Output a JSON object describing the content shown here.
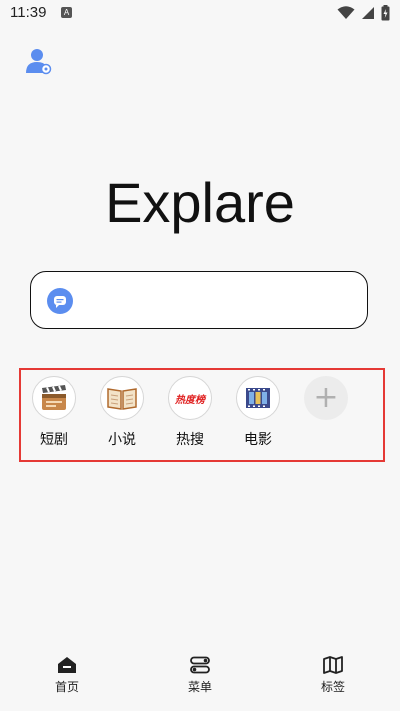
{
  "status_bar": {
    "time": "11:39",
    "notification_letter": "A"
  },
  "app": {
    "title": "Explare"
  },
  "search": {
    "placeholder": "",
    "icon": "chat-bubble-icon",
    "icon_color": "#5b8def"
  },
  "shortcuts": [
    {
      "label": "短剧",
      "icon": "clapperboard-icon"
    },
    {
      "label": "小说",
      "icon": "open-book-icon"
    },
    {
      "label": "热搜",
      "icon": "hot-list-icon",
      "icon_text": "热度榜"
    },
    {
      "label": "电影",
      "icon": "film-strip-icon"
    },
    {
      "label": "",
      "icon": "plus-icon",
      "icon_text": "+"
    }
  ],
  "bottom_nav": [
    {
      "label": "首页",
      "icon": "home-icon"
    },
    {
      "label": "菜单",
      "icon": "menu-toggle-icon"
    },
    {
      "label": "标签",
      "icon": "map-icon"
    }
  ],
  "colors": {
    "background": "#f7f7f7",
    "highlight_border": "#e53935",
    "accent": "#5b8def"
  }
}
